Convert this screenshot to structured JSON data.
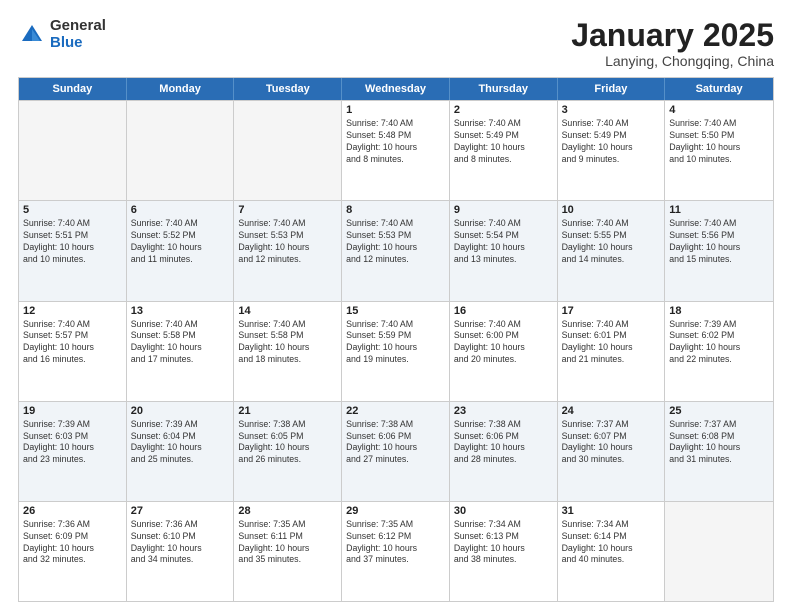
{
  "header": {
    "logo_general": "General",
    "logo_blue": "Blue",
    "title": "January 2025",
    "subtitle": "Lanying, Chongqing, China"
  },
  "weekdays": [
    "Sunday",
    "Monday",
    "Tuesday",
    "Wednesday",
    "Thursday",
    "Friday",
    "Saturday"
  ],
  "rows": [
    [
      {
        "day": "",
        "info": "",
        "empty": true
      },
      {
        "day": "",
        "info": "",
        "empty": true
      },
      {
        "day": "",
        "info": "",
        "empty": true
      },
      {
        "day": "1",
        "info": "Sunrise: 7:40 AM\nSunset: 5:48 PM\nDaylight: 10 hours\nand 8 minutes."
      },
      {
        "day": "2",
        "info": "Sunrise: 7:40 AM\nSunset: 5:49 PM\nDaylight: 10 hours\nand 8 minutes."
      },
      {
        "day": "3",
        "info": "Sunrise: 7:40 AM\nSunset: 5:49 PM\nDaylight: 10 hours\nand 9 minutes."
      },
      {
        "day": "4",
        "info": "Sunrise: 7:40 AM\nSunset: 5:50 PM\nDaylight: 10 hours\nand 10 minutes."
      }
    ],
    [
      {
        "day": "5",
        "info": "Sunrise: 7:40 AM\nSunset: 5:51 PM\nDaylight: 10 hours\nand 10 minutes."
      },
      {
        "day": "6",
        "info": "Sunrise: 7:40 AM\nSunset: 5:52 PM\nDaylight: 10 hours\nand 11 minutes."
      },
      {
        "day": "7",
        "info": "Sunrise: 7:40 AM\nSunset: 5:53 PM\nDaylight: 10 hours\nand 12 minutes."
      },
      {
        "day": "8",
        "info": "Sunrise: 7:40 AM\nSunset: 5:53 PM\nDaylight: 10 hours\nand 12 minutes."
      },
      {
        "day": "9",
        "info": "Sunrise: 7:40 AM\nSunset: 5:54 PM\nDaylight: 10 hours\nand 13 minutes."
      },
      {
        "day": "10",
        "info": "Sunrise: 7:40 AM\nSunset: 5:55 PM\nDaylight: 10 hours\nand 14 minutes."
      },
      {
        "day": "11",
        "info": "Sunrise: 7:40 AM\nSunset: 5:56 PM\nDaylight: 10 hours\nand 15 minutes."
      }
    ],
    [
      {
        "day": "12",
        "info": "Sunrise: 7:40 AM\nSunset: 5:57 PM\nDaylight: 10 hours\nand 16 minutes."
      },
      {
        "day": "13",
        "info": "Sunrise: 7:40 AM\nSunset: 5:58 PM\nDaylight: 10 hours\nand 17 minutes."
      },
      {
        "day": "14",
        "info": "Sunrise: 7:40 AM\nSunset: 5:58 PM\nDaylight: 10 hours\nand 18 minutes."
      },
      {
        "day": "15",
        "info": "Sunrise: 7:40 AM\nSunset: 5:59 PM\nDaylight: 10 hours\nand 19 minutes."
      },
      {
        "day": "16",
        "info": "Sunrise: 7:40 AM\nSunset: 6:00 PM\nDaylight: 10 hours\nand 20 minutes."
      },
      {
        "day": "17",
        "info": "Sunrise: 7:40 AM\nSunset: 6:01 PM\nDaylight: 10 hours\nand 21 minutes."
      },
      {
        "day": "18",
        "info": "Sunrise: 7:39 AM\nSunset: 6:02 PM\nDaylight: 10 hours\nand 22 minutes."
      }
    ],
    [
      {
        "day": "19",
        "info": "Sunrise: 7:39 AM\nSunset: 6:03 PM\nDaylight: 10 hours\nand 23 minutes."
      },
      {
        "day": "20",
        "info": "Sunrise: 7:39 AM\nSunset: 6:04 PM\nDaylight: 10 hours\nand 25 minutes."
      },
      {
        "day": "21",
        "info": "Sunrise: 7:38 AM\nSunset: 6:05 PM\nDaylight: 10 hours\nand 26 minutes."
      },
      {
        "day": "22",
        "info": "Sunrise: 7:38 AM\nSunset: 6:06 PM\nDaylight: 10 hours\nand 27 minutes."
      },
      {
        "day": "23",
        "info": "Sunrise: 7:38 AM\nSunset: 6:06 PM\nDaylight: 10 hours\nand 28 minutes."
      },
      {
        "day": "24",
        "info": "Sunrise: 7:37 AM\nSunset: 6:07 PM\nDaylight: 10 hours\nand 30 minutes."
      },
      {
        "day": "25",
        "info": "Sunrise: 7:37 AM\nSunset: 6:08 PM\nDaylight: 10 hours\nand 31 minutes."
      }
    ],
    [
      {
        "day": "26",
        "info": "Sunrise: 7:36 AM\nSunset: 6:09 PM\nDaylight: 10 hours\nand 32 minutes."
      },
      {
        "day": "27",
        "info": "Sunrise: 7:36 AM\nSunset: 6:10 PM\nDaylight: 10 hours\nand 34 minutes."
      },
      {
        "day": "28",
        "info": "Sunrise: 7:35 AM\nSunset: 6:11 PM\nDaylight: 10 hours\nand 35 minutes."
      },
      {
        "day": "29",
        "info": "Sunrise: 7:35 AM\nSunset: 6:12 PM\nDaylight: 10 hours\nand 37 minutes."
      },
      {
        "day": "30",
        "info": "Sunrise: 7:34 AM\nSunset: 6:13 PM\nDaylight: 10 hours\nand 38 minutes."
      },
      {
        "day": "31",
        "info": "Sunrise: 7:34 AM\nSunset: 6:14 PM\nDaylight: 10 hours\nand 40 minutes."
      },
      {
        "day": "",
        "info": "",
        "empty": true
      }
    ]
  ]
}
